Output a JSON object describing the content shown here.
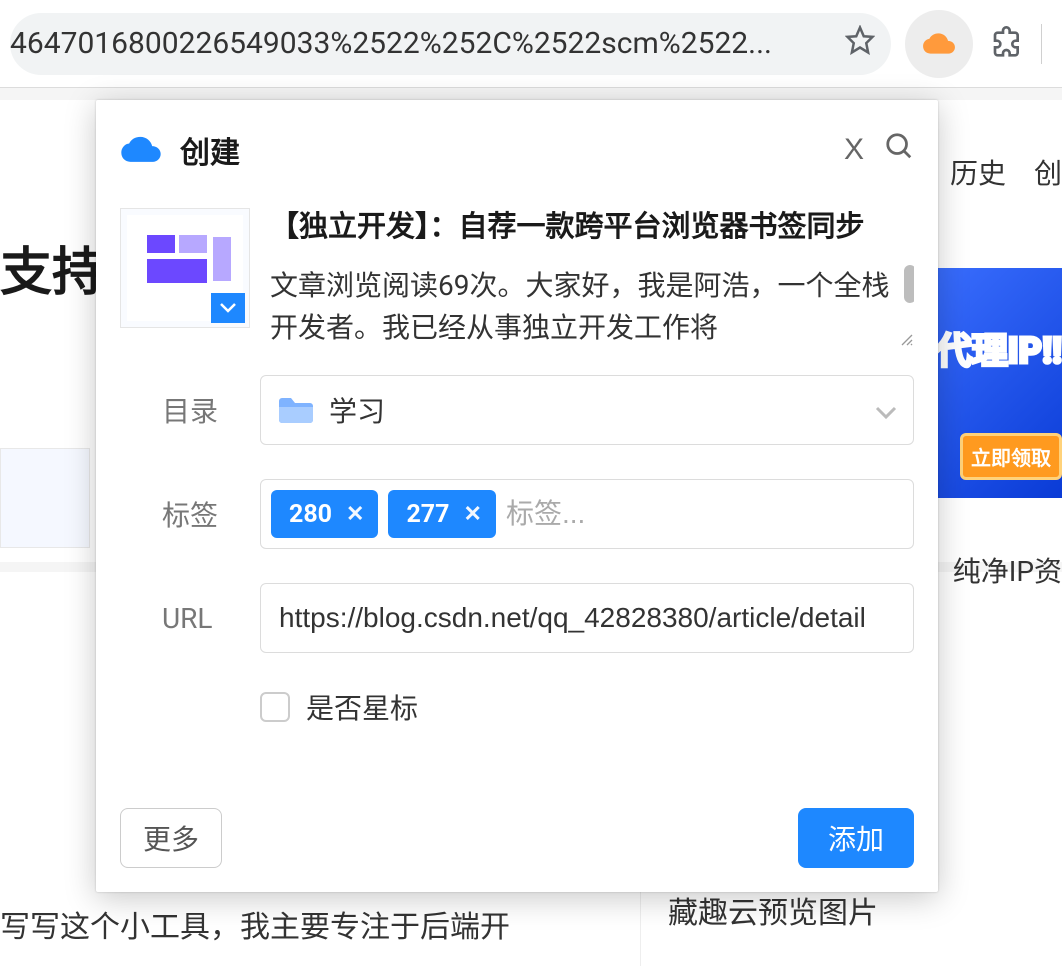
{
  "browser": {
    "url_fragment": "4647016800226549033%2522%252C%2522scm%2522..."
  },
  "background": {
    "nav_history": "历史",
    "nav_create": "创",
    "heading": "支持",
    "banner_line1": "",
    "banner_line2": "代理IP!!",
    "banner_cta": "立即领取",
    "side_text": "纯净IP资",
    "bottom_left": "写写这个小工具，我主要专注于后端开",
    "bottom_right": "藏趣云预览图片"
  },
  "popup": {
    "title": "创建",
    "bookmark_title": "【独立开发】：自荐一款跨平台浏览器书签同步",
    "bookmark_desc": "文章浏览阅读69次。大家好，我是阿浩，一个全栈开发者。我已经从事独立开发工作将",
    "form": {
      "dir_label": "目录",
      "dir_value": "学习",
      "tag_label": "标签",
      "tags": [
        "280",
        "277"
      ],
      "tag_placeholder": "标签...",
      "url_label": "URL",
      "url_value": "https://blog.csdn.net/qq_42828380/article/detail",
      "star_label": "是否星标"
    },
    "more_button": "更多",
    "add_button": "添加"
  }
}
